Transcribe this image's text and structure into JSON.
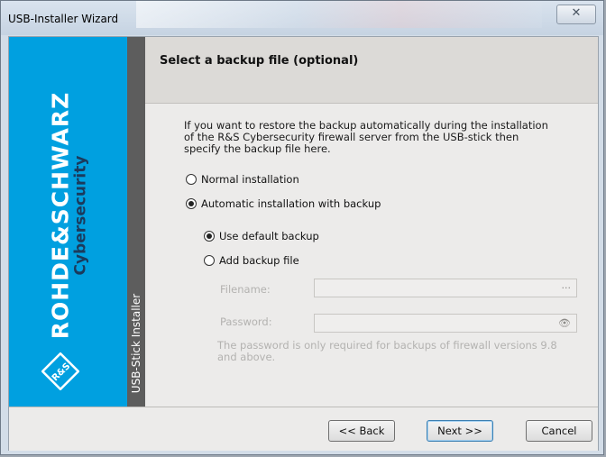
{
  "window": {
    "title": "USB-Installer Wizard",
    "close_glyph": "✕"
  },
  "brand": {
    "company": "ROHDE&SCHWARZ",
    "division": "Cybersecurity",
    "logo_text": "R&S",
    "side_label": "USB-Stick Installer",
    "colors": {
      "brand_blue": "#00a0e0",
      "strip_gray": "#5d5d5d"
    }
  },
  "page": {
    "title": "Select a backup file (optional)",
    "description": "If you want to restore the backup automatically during the installation of the R&S Cybersecurity firewall server from the USB-stick then specify the backup file here."
  },
  "install_mode": {
    "options": [
      {
        "label": "Normal installation",
        "selected": false
      },
      {
        "label": "Automatic installation with backup",
        "selected": true
      }
    ]
  },
  "backup_source": {
    "options": [
      {
        "label": "Use default backup",
        "selected": true
      },
      {
        "label": "Add backup file",
        "selected": false
      }
    ]
  },
  "fields": {
    "filename": {
      "label": "Filename:",
      "value": "",
      "button_glyph": "···",
      "icon": "browse-icon"
    },
    "password": {
      "label": "Password:",
      "value": "",
      "button_glyph": "👁",
      "icon": "show-password-icon"
    }
  },
  "note": "The password is only required for backups of firewall versions 9.8 and above.",
  "buttons": {
    "back": "<< Back",
    "next": "Next >>",
    "cancel": "Cancel"
  }
}
